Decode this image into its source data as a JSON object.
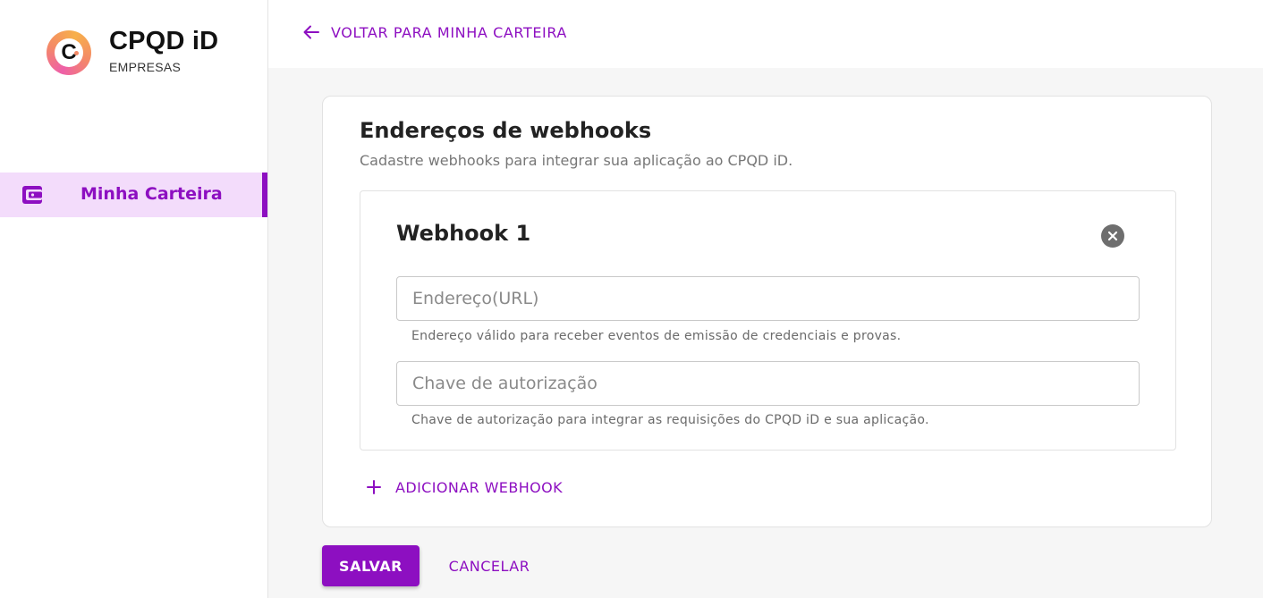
{
  "brand": {
    "name": "CPQD iD",
    "subtitle": "EMPRESAS",
    "logo_letter": "C"
  },
  "sidebar": {
    "items": [
      {
        "label": "Minha Carteira",
        "icon": "wallet-icon",
        "active": true
      }
    ]
  },
  "topbar": {
    "back_label": "VOLTAR PARA MINHA CARTEIRA"
  },
  "card": {
    "title": "Endereços de webhooks",
    "subtitle": "Cadastre webhooks para integrar sua aplicação ao CPQD iD.",
    "webhooks": [
      {
        "title": "Webhook 1",
        "url_placeholder": "Endereço(URL)",
        "url_value": "",
        "url_helper": "Endereço válido para receber eventos de emissão de credenciais e provas.",
        "key_placeholder": "Chave de autorização",
        "key_value": "",
        "key_helper": "Chave de autorização para integrar as requisições do CPQD iD e sua aplicação."
      }
    ],
    "add_label": "ADICIONAR WEBHOOK"
  },
  "actions": {
    "save_label": "SALVAR",
    "cancel_label": "CANCELAR"
  },
  "colors": {
    "accent": "#8d0fc1",
    "nav_active_bg": "#f3dcfb",
    "close_icon_bg": "#6e6e6e"
  }
}
